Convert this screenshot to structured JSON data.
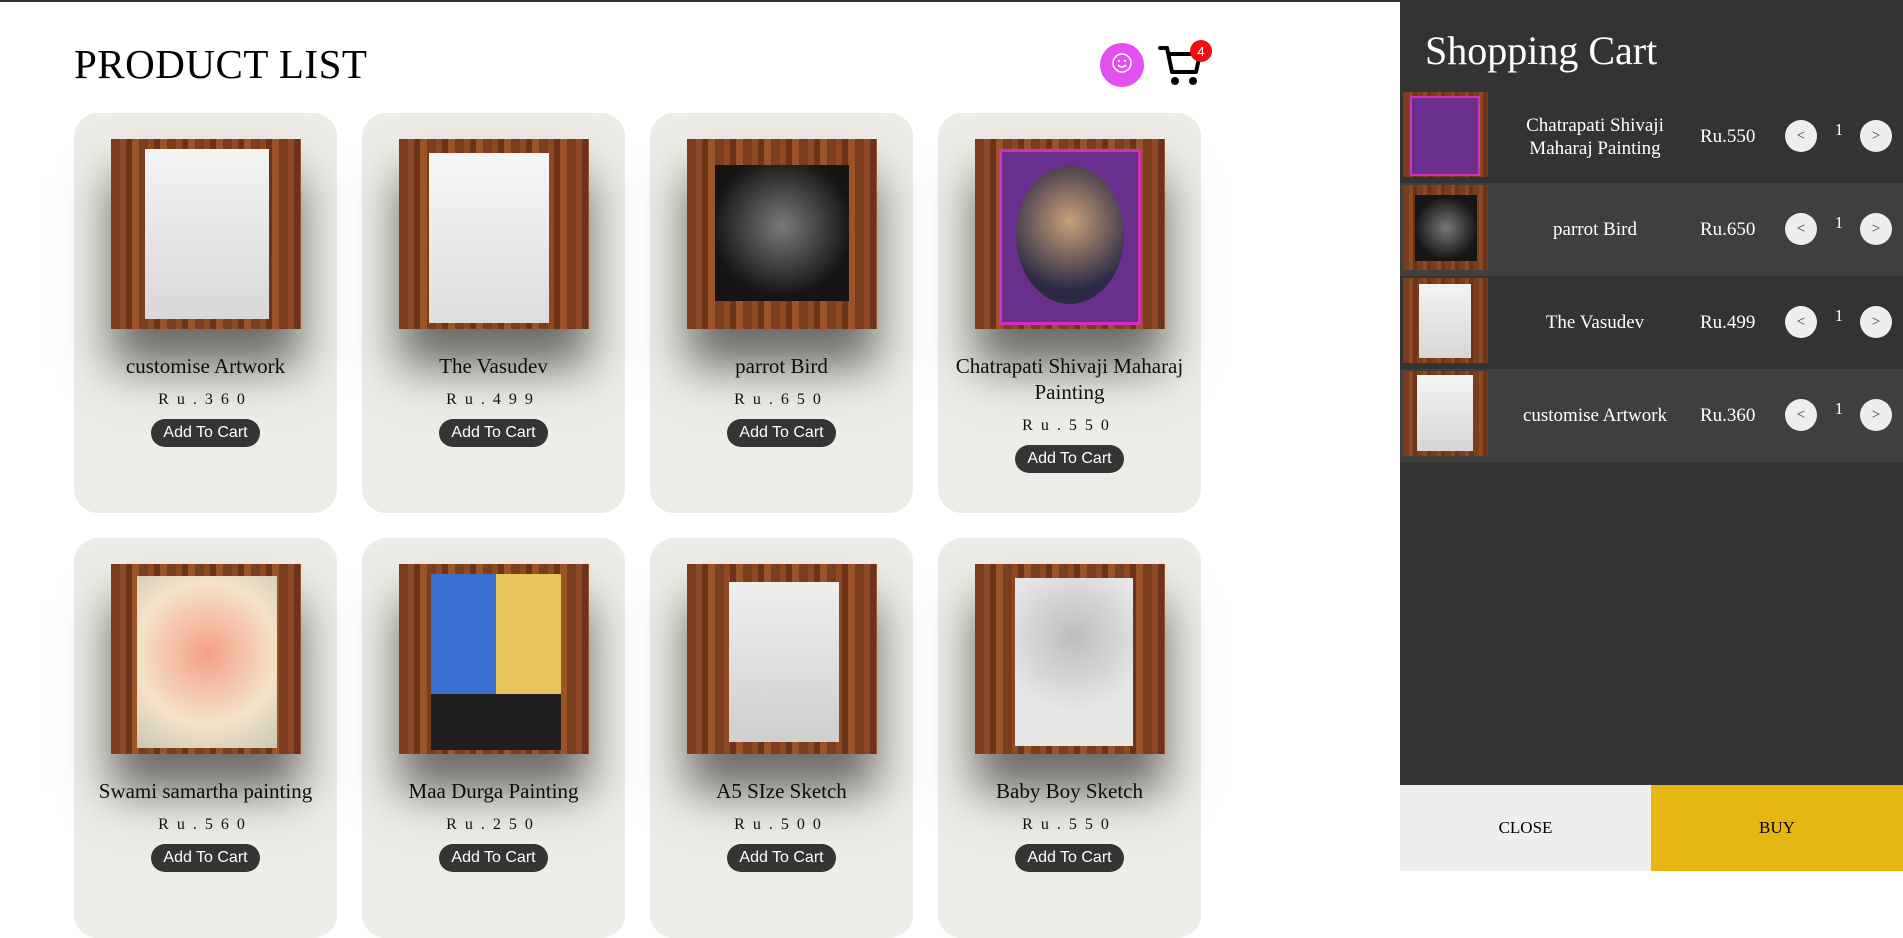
{
  "header": {
    "title": "PRODUCT LIST",
    "user_icon": "smiley-face-icon",
    "cart_icon": "shopping-cart-icon",
    "cart_count": "4"
  },
  "colors": {
    "accent_user": "#e34ff0",
    "badge": "#f20f0f",
    "button_dark": "#353535",
    "panel": "#333333",
    "buy": "#e6b713"
  },
  "products": [
    {
      "name": "customise Artwork",
      "price": "Ru.360",
      "button": "Add To Cart"
    },
    {
      "name": "The Vasudev",
      "price": "Ru.499",
      "button": "Add To Cart"
    },
    {
      "name": "parrot Bird",
      "price": "Ru.650",
      "button": "Add To Cart"
    },
    {
      "name": "Chatrapati Shivaji Maharaj Painting",
      "price": "Ru.550",
      "button": "Add To Cart"
    },
    {
      "name": "Swami samartha painting",
      "price": "Ru.560",
      "button": "Add To Cart"
    },
    {
      "name": "Maa Durga Painting",
      "price": "Ru.250",
      "button": "Add To Cart"
    },
    {
      "name": "A5 SIze Sketch",
      "price": "Ru.500",
      "button": "Add To Cart"
    },
    {
      "name": "Baby Boy Sketch",
      "price": "Ru.550",
      "button": "Add To Cart"
    }
  ],
  "cart": {
    "title": "Shopping Cart",
    "items": [
      {
        "name": "Chatrapati Shivaji Maharaj Painting",
        "price": "Ru.550",
        "qty": "1",
        "dec": "<",
        "inc": ">"
      },
      {
        "name": "parrot Bird",
        "price": "Ru.650",
        "qty": "1",
        "dec": "<",
        "inc": ">"
      },
      {
        "name": "The Vasudev",
        "price": "Ru.499",
        "qty": "1",
        "dec": "<",
        "inc": ">"
      },
      {
        "name": "customise Artwork",
        "price": "Ru.360",
        "qty": "1",
        "dec": "<",
        "inc": ">"
      }
    ],
    "close_label": "CLOSE",
    "buy_label": "BUY"
  }
}
